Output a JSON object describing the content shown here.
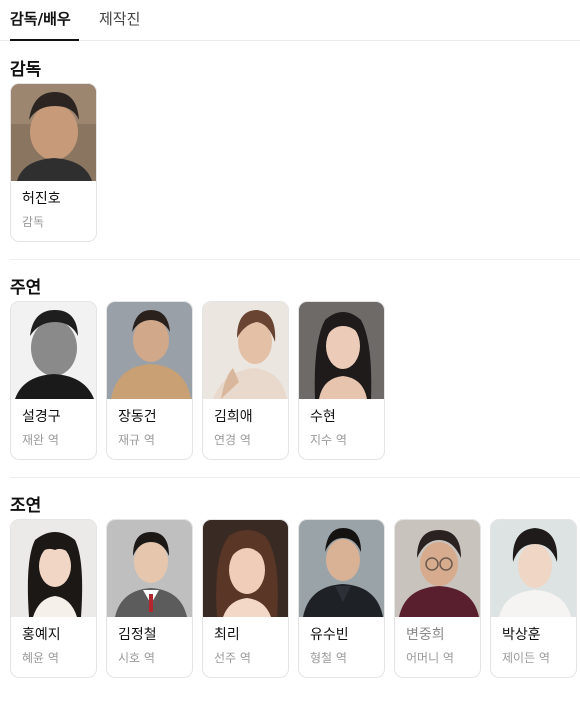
{
  "tabs": [
    {
      "label": "감독/배우",
      "active": true
    },
    {
      "label": "제작진",
      "active": false
    }
  ],
  "sections": {
    "director": {
      "title": "감독",
      "people": [
        {
          "name": "허진호",
          "role": "감독"
        }
      ]
    },
    "lead": {
      "title": "주연",
      "people": [
        {
          "name": "설경구",
          "role": "재완 역"
        },
        {
          "name": "장동건",
          "role": "재규 역"
        },
        {
          "name": "김희애",
          "role": "연경 역"
        },
        {
          "name": "수현",
          "role": "지수 역"
        }
      ]
    },
    "supporting": {
      "title": "조연",
      "people": [
        {
          "name": "홍예지",
          "role": "혜윤 역"
        },
        {
          "name": "김정철",
          "role": "시호 역"
        },
        {
          "name": "최리",
          "role": "선주 역"
        },
        {
          "name": "유수빈",
          "role": "형철 역"
        },
        {
          "name": "변중희",
          "role": "어머니 역"
        },
        {
          "name": "박상훈",
          "role": "제이든 역"
        }
      ]
    }
  },
  "colors": {
    "text_primary": "#111111",
    "text_secondary": "#9a9a9a",
    "card_border": "#e4e4e4",
    "divider": "#eeeeee"
  }
}
